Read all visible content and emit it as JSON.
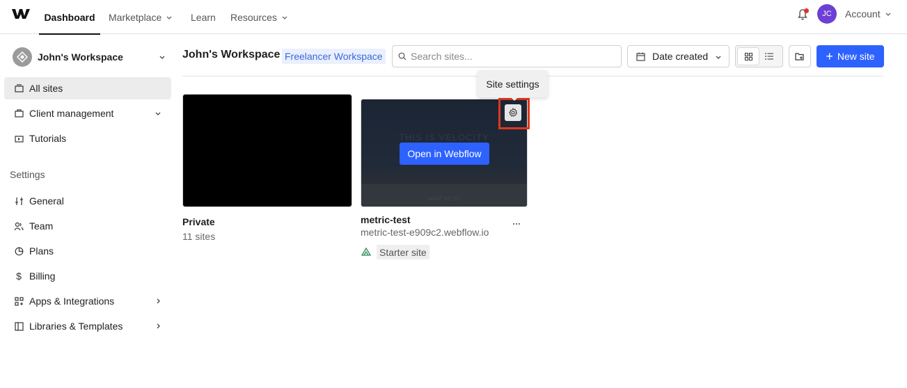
{
  "topnav": {
    "items": [
      {
        "label": "Dashboard"
      },
      {
        "label": "Marketplace"
      },
      {
        "label": "Learn"
      },
      {
        "label": "Resources"
      }
    ],
    "avatar_initials": "JC",
    "account_label": "Account",
    "notification_dot_color": "#e5322d"
  },
  "sidebar": {
    "workspace_name": "John's Workspace",
    "items": [
      {
        "label": "All sites",
        "icon": "sites-icon"
      },
      {
        "label": "Client management",
        "icon": "client-icon"
      },
      {
        "label": "Tutorials",
        "icon": "tutorials-icon"
      }
    ],
    "settings_heading": "Settings",
    "settings_items": [
      {
        "label": "General",
        "icon": "sliders-icon"
      },
      {
        "label": "Team",
        "icon": "team-icon"
      },
      {
        "label": "Plans",
        "icon": "plans-icon"
      },
      {
        "label": "Billing",
        "icon": "dollar-icon"
      },
      {
        "label": "Apps & Integrations",
        "icon": "apps-icon"
      },
      {
        "label": "Libraries & Templates",
        "icon": "libraries-icon"
      }
    ]
  },
  "main": {
    "title": "John's Workspace",
    "workspace_badge": "Freelancer Workspace",
    "search_placeholder": "Search sites...",
    "sort_label": "Date created",
    "new_site_label": "New site",
    "tooltip": "Site settings",
    "folder": {
      "name": "Private",
      "count": "11 sites"
    },
    "site": {
      "open_label": "Open in Webflow",
      "thumb_text": "THIS IS VELOCITY",
      "thumb_sub": "WHAT WE DO",
      "name": "metric-test",
      "url": "metric-test-e909c2.webflow.io",
      "badge": "Starter site"
    }
  },
  "colors": {
    "accent": "#2d62ff",
    "badge_bg": "#ebf0ff",
    "badge_text": "#3b67d6",
    "highlight": "#e0381d",
    "avatar": "#6c3fd6"
  }
}
